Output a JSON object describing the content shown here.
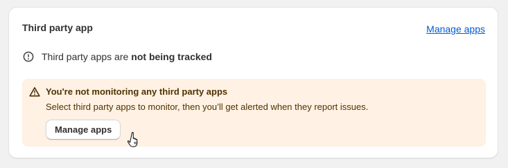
{
  "card": {
    "title": "Third party app",
    "header_link": "Manage apps"
  },
  "status": {
    "icon": "info-circle-icon",
    "text_prefix": "Third party apps are",
    "text_bold": "not being tracked"
  },
  "banner": {
    "icon": "warning-triangle-icon",
    "title": "You're not monitoring any third party apps",
    "body": "Select third party apps to monitor, then you’ll get alerted when they report issues.",
    "button_label": "Manage apps"
  },
  "colors": {
    "link": "#005bd3",
    "banner_bg": "#fff1e3",
    "banner_text": "#4f3203"
  }
}
